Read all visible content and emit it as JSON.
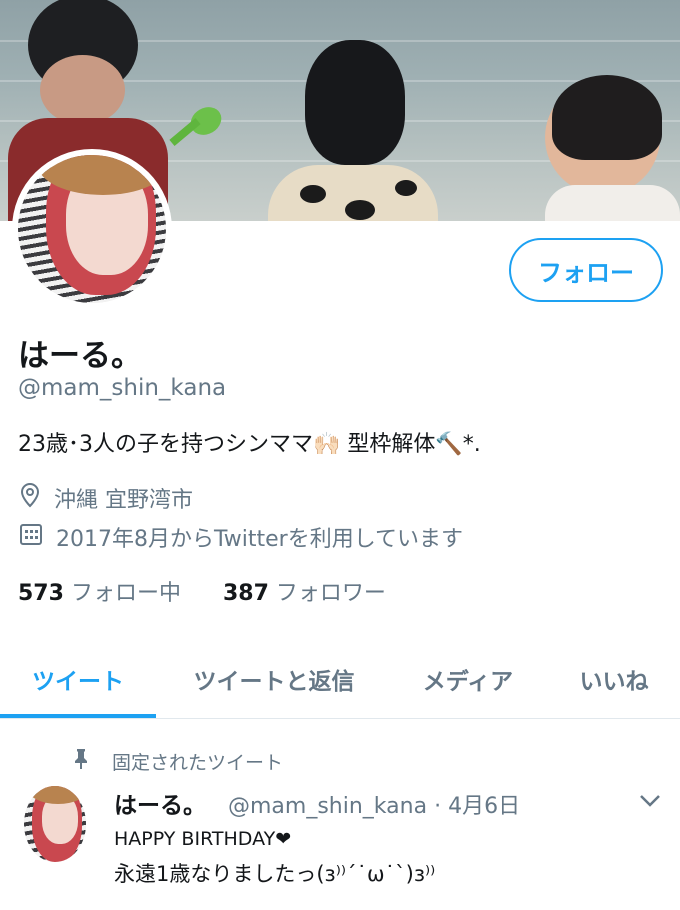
{
  "profile": {
    "follow_label": "フォロー",
    "name": "はーる。",
    "handle": "@mam_shin_kana",
    "bio": "23歳･3人の子を持つシンママ🙌🏻 型枠解体🔨*.",
    "location": "沖縄 宜野湾市",
    "joined": "2017年8月からTwitterを利用しています",
    "following_count": "573",
    "following_label": "フォロー中",
    "followers_count": "387",
    "followers_label": "フォロワー"
  },
  "tabs": [
    {
      "label": "ツイート",
      "active": true
    },
    {
      "label": "ツイートと返信",
      "active": false
    },
    {
      "label": "メディア",
      "active": false
    },
    {
      "label": "いいね",
      "active": false
    }
  ],
  "pinned_tweet": {
    "pinned_label": "固定されたツイート",
    "author_name": "はーる。",
    "author_handle": "@mam_shin_kana",
    "separator": "·",
    "date": "4月6日",
    "line1": "HAPPY BIRTHDAY❤",
    "line2": "永遠1歳なりましたっ(ɜ⁾⁾ˊ˙ω˙ˋ)ɜ⁾⁾"
  },
  "icons": {
    "location": "location-pin-icon",
    "calendar": "calendar-icon",
    "pin": "pin-icon",
    "more": "chevron-down-icon"
  },
  "colors": {
    "accent": "#1da1f2",
    "secondary_text": "#657786",
    "primary_text": "#14171a",
    "divider": "#e1e8ed"
  }
}
